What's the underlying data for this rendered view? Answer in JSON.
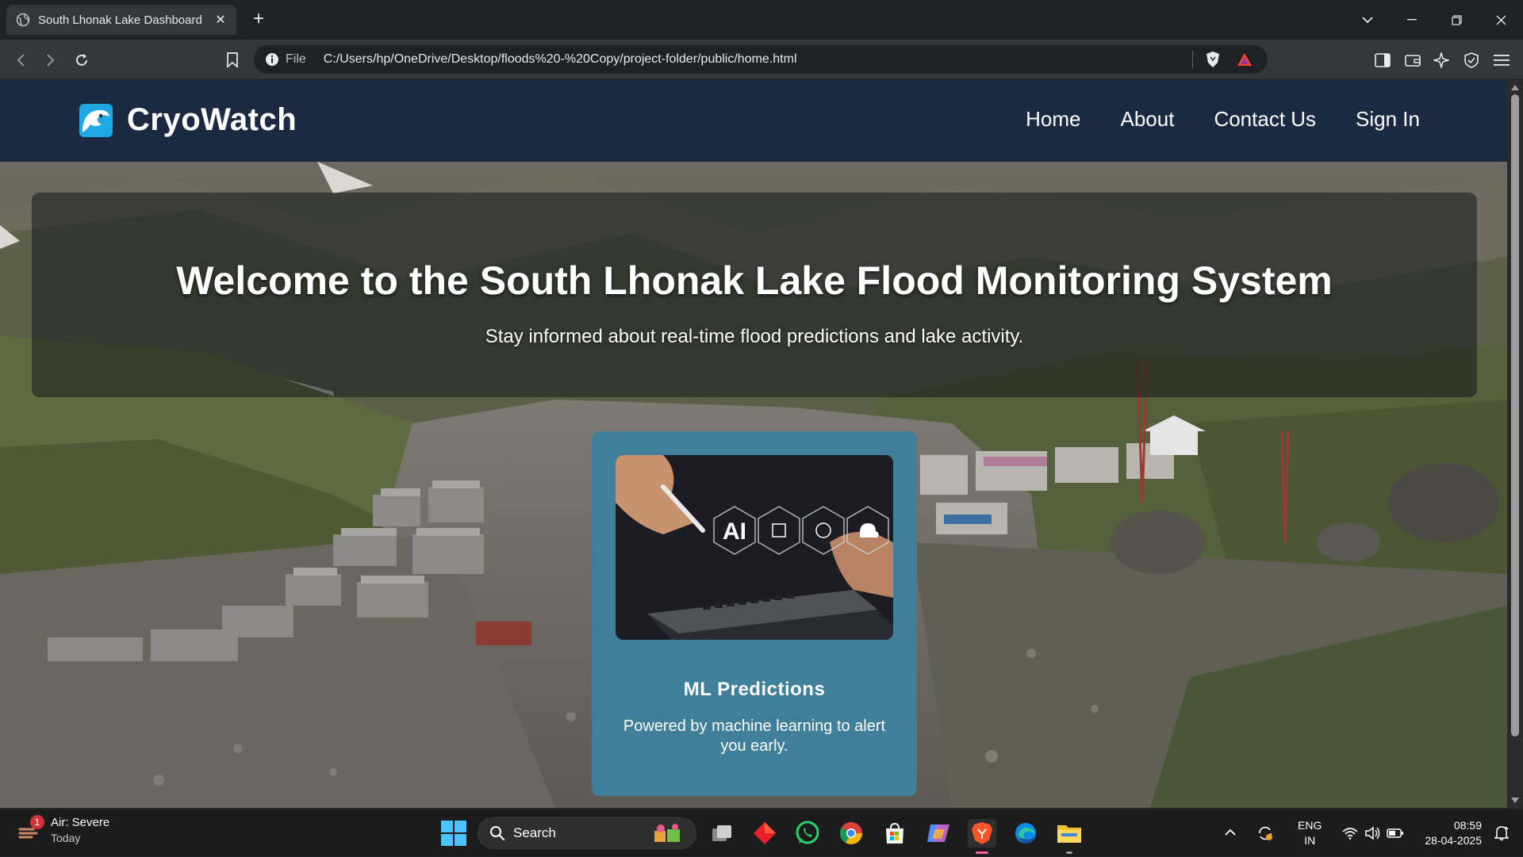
{
  "browser": {
    "tab_title": "South Lhonak Lake Dashboard",
    "tab_close": "✕",
    "new_tab": "+",
    "file_label": "File",
    "url": "C:/Users/hp/OneDrive/Desktop/floods%20-%20Copy/project-folder/public/home.html"
  },
  "site": {
    "brand_name": "CryoWatch",
    "nav": [
      "Home",
      "About",
      "Contact Us",
      "Sign In"
    ],
    "welcome_title": "Welcome to the South Lhonak Lake Flood Monitoring System",
    "welcome_subtitle": "Stay informed about real-time flood predictions and lake activity.",
    "card": {
      "image_text": "AI",
      "title": "ML Predictions",
      "description": "Powered by machine learning to alert you early."
    }
  },
  "taskbar": {
    "weather_title": "Air: Severe",
    "weather_sub": "Today",
    "weather_badge": "1",
    "search_label": "Search",
    "lang_line1": "ENG",
    "lang_line2": "IN",
    "time": "08:59",
    "date": "28-04-2025"
  },
  "colors": {
    "site_header": "#1b2a41",
    "card": "#3f7f99",
    "browser_chrome": "#35363a",
    "taskbar": "#1c1c1c"
  }
}
